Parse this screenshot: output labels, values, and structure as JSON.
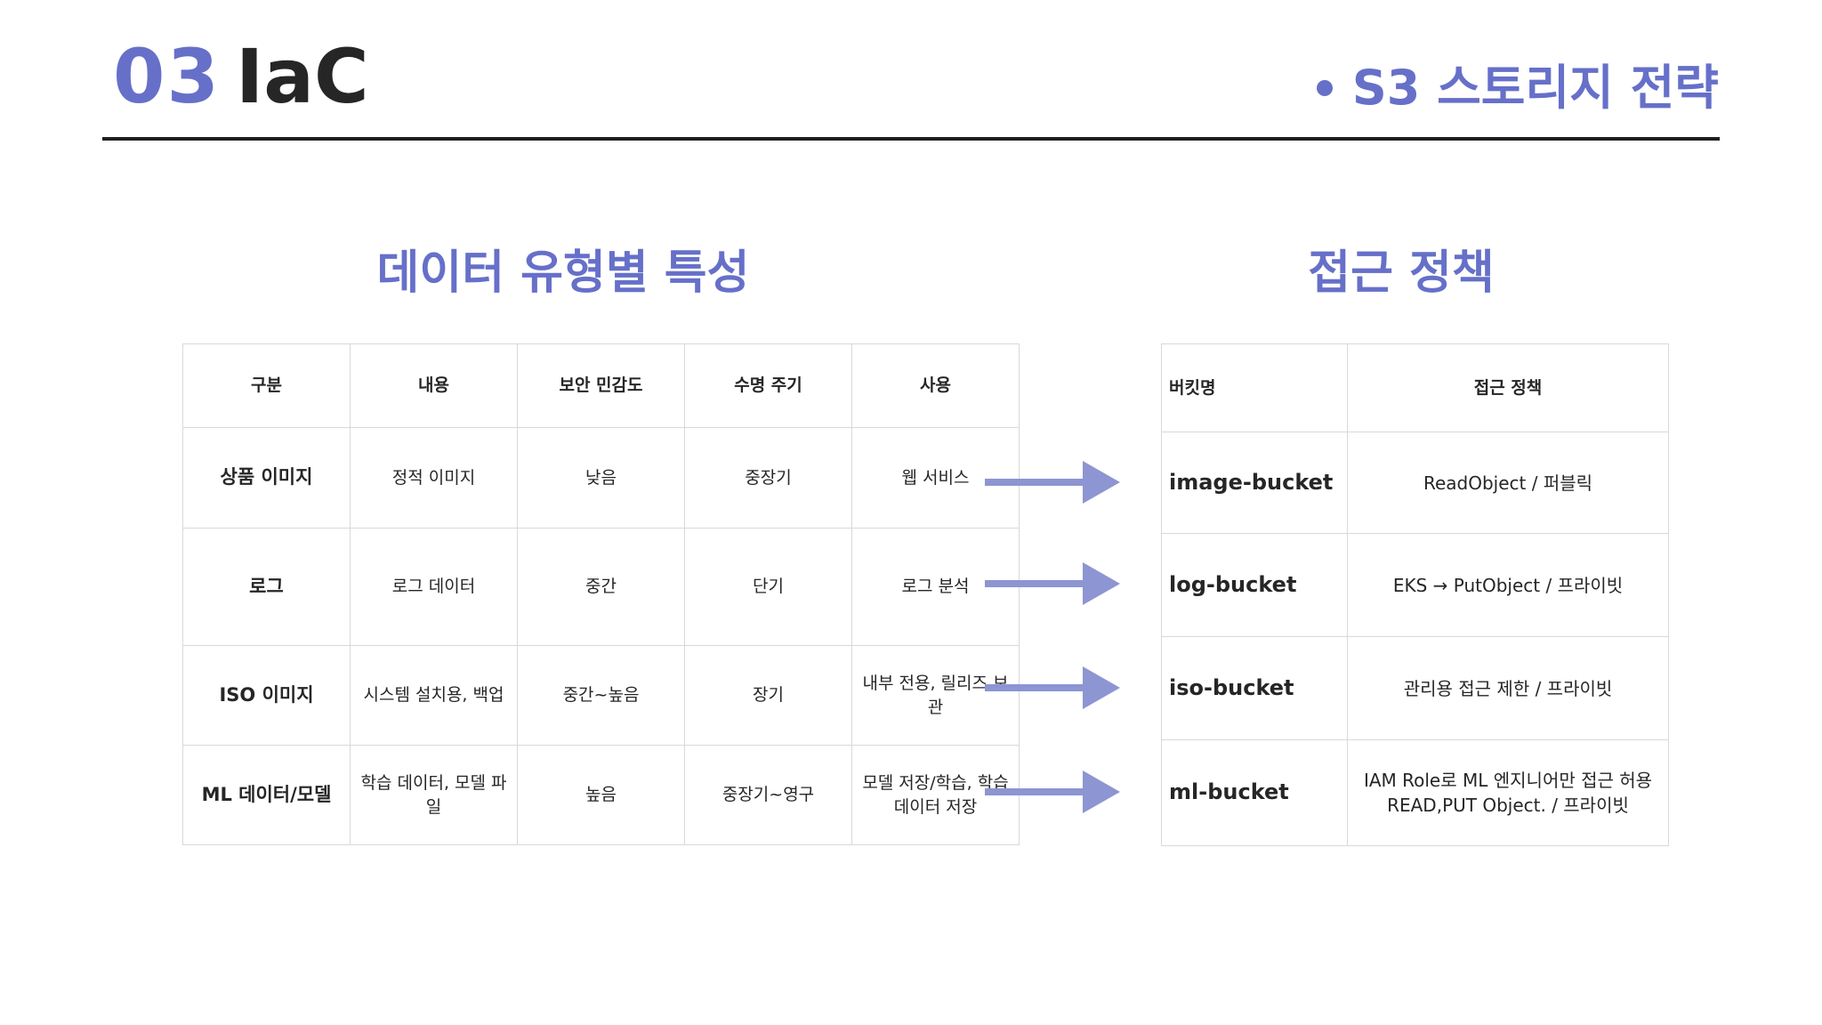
{
  "header": {
    "number": "03",
    "title": "IaC",
    "section": "S3 스토리지 전략",
    "accent_color": "#6670c9"
  },
  "left_section": {
    "heading": "데이터 유형별 특성",
    "columns": [
      "구분",
      "내용",
      "보안 민감도",
      "수명 주기",
      "사용"
    ],
    "rows": [
      [
        "상품 이미지",
        "정적 이미지",
        "낮음",
        "중장기",
        "웹 서비스"
      ],
      [
        "로그",
        "로그 데이터",
        "중간",
        "단기",
        "로그 분석"
      ],
      [
        "ISO 이미지",
        "시스템 설치용, 백업",
        "중간~높음",
        "장기",
        "내부 전용, 릴리즈 보관"
      ],
      [
        "ML 데이터/모델",
        "학습 데이터, 모델 파일",
        "높음",
        "중장기~영구",
        "모델 저장/학습, 학습 데이터 저장"
      ]
    ]
  },
  "right_section": {
    "heading": "접근 정책",
    "columns": [
      "버킷명",
      "접근 정책"
    ],
    "rows": [
      [
        "image-bucket",
        "ReadObject / 퍼블릭"
      ],
      [
        "log-bucket",
        "EKS → PutObject / 프라이빗"
      ],
      [
        "iso-bucket",
        "관리용 접근 제한 / 프라이빗"
      ],
      [
        "ml-bucket",
        "IAM Role로 ML 엔지니어만 접근 허용 READ,PUT Object. / 프라이빗"
      ]
    ]
  },
  "arrow_color": "#8d95d2"
}
